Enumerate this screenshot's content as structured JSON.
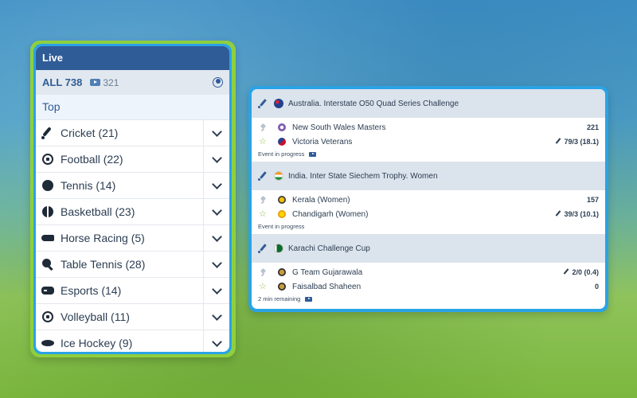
{
  "sidebar": {
    "title": "Live",
    "all_label": "ALL 738",
    "video_count": "321",
    "top_label": "Top",
    "sports": [
      {
        "label": "Cricket (21)",
        "icon": "cricket-icon"
      },
      {
        "label": "Football (22)",
        "icon": "football-icon"
      },
      {
        "label": "Tennis (14)",
        "icon": "tennis-icon"
      },
      {
        "label": "Basketball (23)",
        "icon": "basketball-icon"
      },
      {
        "label": "Horse Racing (5)",
        "icon": "horse-racing-icon"
      },
      {
        "label": "Table Tennis (28)",
        "icon": "table-tennis-icon"
      },
      {
        "label": "Esports (14)",
        "icon": "esports-icon"
      },
      {
        "label": "Volleyball (11)",
        "icon": "volleyball-icon"
      },
      {
        "label": "Ice Hockey (9)",
        "icon": "ice-hockey-icon"
      }
    ]
  },
  "events": [
    {
      "league": "Australia. Interstate O50 Quad Series Challenge",
      "flag": "australia-flag-icon",
      "team1": "New South Wales Masters",
      "score1": "221",
      "team2": "Victoria Veterans",
      "score2": "79/3 (18.1)",
      "status": "Event in progress"
    },
    {
      "league": "India. Inter State Siechem Trophy. Women",
      "flag": "india-flag-icon",
      "team1": "Kerala (Women)",
      "score1": "157",
      "team2": "Chandigarh (Women)",
      "score2": "39/3 (10.1)",
      "status": "Event in progress"
    },
    {
      "league": "Karachi Challenge Cup",
      "flag": "pakistan-flag-icon",
      "team1": "G Team Gujarawala",
      "score1": "2/0 (0.4)",
      "team2": "Faisalbad Shaheen",
      "score2": "0",
      "status": "2 min remaining"
    }
  ],
  "colors": {
    "header_blue": "#2f5c97",
    "frame_blue": "#2aa3e6",
    "frame_green": "#8fcf3e",
    "star_green": "#8fbf3a"
  }
}
